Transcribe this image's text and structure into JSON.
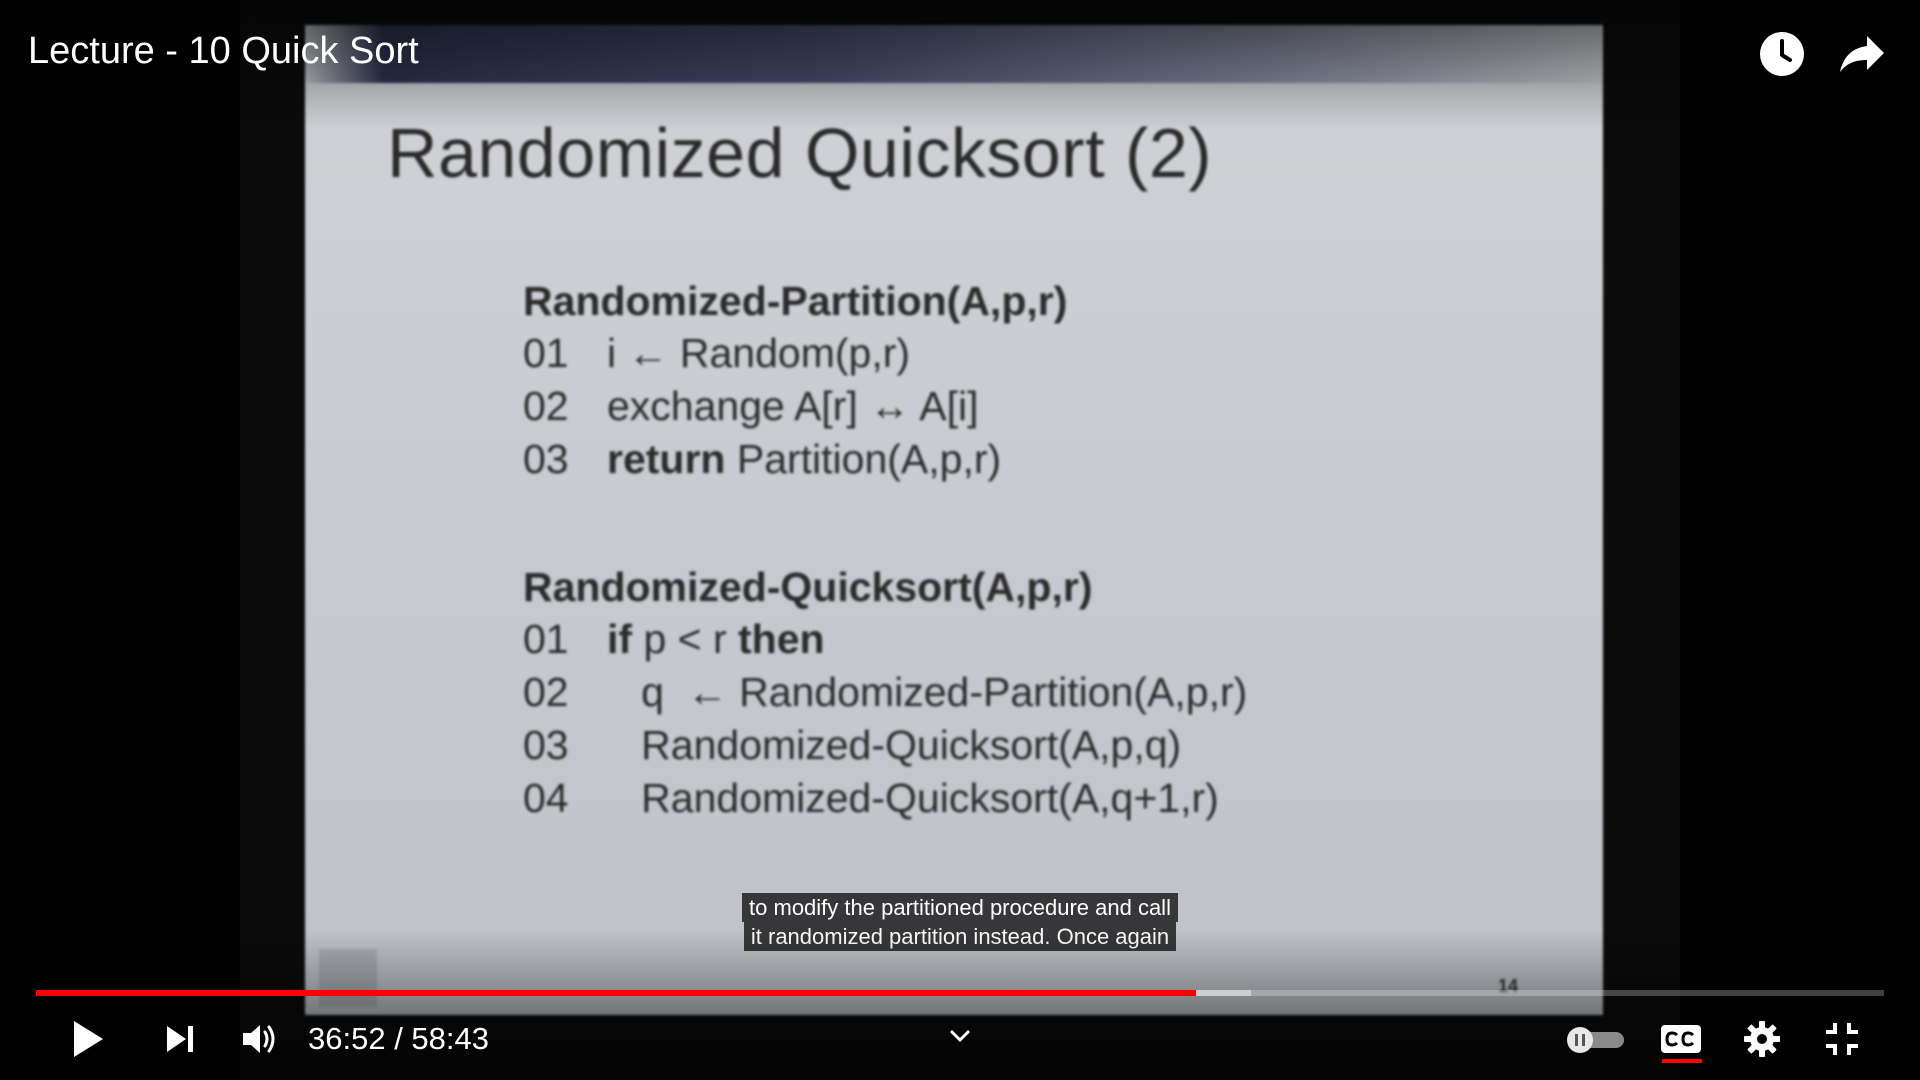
{
  "video": {
    "title": "Lecture - 10 Quick Sort",
    "slide": {
      "title": "Randomized Quicksort (2)",
      "page_number": "14",
      "block1": {
        "header": "Randomized-Partition(A,p,r)",
        "lines": [
          {
            "num": "01",
            "kw": "",
            "text": "i  ← Random(p,r)"
          },
          {
            "num": "02",
            "kw": "",
            "text": "exchange A[r] ↔ A[i]"
          },
          {
            "num": "03",
            "kw": "return",
            "text": " Partition(A,p,r)"
          }
        ]
      },
      "block2": {
        "header": "Randomized-Quicksort(A,p,r)",
        "lines": [
          {
            "num": "01",
            "kw": "if",
            "text": " p < r ",
            "kw2": "then"
          },
          {
            "num": "02",
            "kw": "",
            "text": "   q  ← Randomized-Partition(A,p,r)"
          },
          {
            "num": "03",
            "kw": "",
            "text": "   Randomized-Quicksort(A,p,q)"
          },
          {
            "num": "04",
            "kw": "",
            "text": "   Randomized-Quicksort(A,q+1,r)"
          }
        ]
      }
    }
  },
  "captions": {
    "line1": "to modify the partitioned procedure and call",
    "line2": "it randomized partition instead. Once again"
  },
  "player": {
    "current_time": "36:52",
    "duration": "58:43",
    "time_text": "36:52 / 58:43",
    "progress_fraction": 0.6277,
    "buffer_fraction": 0.6577,
    "accent_color": "#ff0000",
    "icons": {
      "watch_later": "clock-icon",
      "share": "share-arrow-icon",
      "play": "play-icon",
      "next": "next-icon",
      "volume": "volume-icon",
      "chapters": "chevron-down-icon",
      "autoplay": "autoplay-toggle-icon",
      "captions": "cc-icon",
      "settings": "gear-icon",
      "exit_fullscreen": "exit-fullscreen-icon"
    }
  }
}
